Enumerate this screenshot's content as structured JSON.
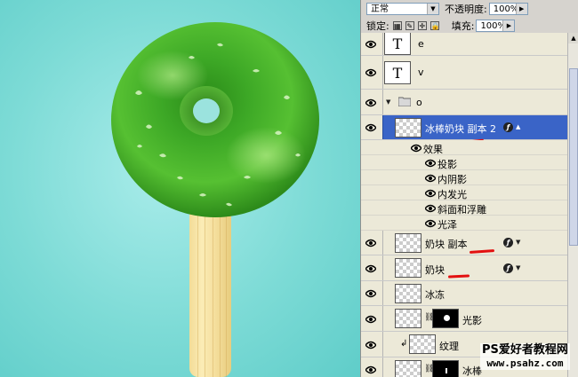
{
  "toolbar": {
    "blend_mode": "正常",
    "opacity_label": "不透明度:",
    "opacity_value": "100%",
    "lock_label": "锁定:",
    "fill_label": "填充:",
    "fill_value": "100%"
  },
  "layers": [
    {
      "id": "layer-e",
      "name": "e",
      "type": "text",
      "visible": true
    },
    {
      "id": "layer-v",
      "name": "v",
      "type": "text",
      "visible": true
    },
    {
      "id": "group-o",
      "name": "o",
      "type": "group",
      "visible": true
    },
    {
      "id": "layer-icebar-copy2",
      "name": "冰棒奶块 副本 2",
      "type": "pixel",
      "visible": true,
      "selected": true,
      "has_fx": true,
      "effects_label": "效果",
      "effects": [
        "投影",
        "内阴影",
        "内发光",
        "斜面和浮雕",
        "光泽"
      ]
    },
    {
      "id": "layer-milk-copy",
      "name": "奶块 副本",
      "type": "pixel",
      "visible": true,
      "has_fx": true
    },
    {
      "id": "layer-milk",
      "name": "奶块",
      "type": "pixel",
      "visible": true,
      "has_fx": true
    },
    {
      "id": "layer-ice",
      "name": "冰冻",
      "type": "pixel",
      "visible": true
    },
    {
      "id": "layer-light",
      "name": "光影",
      "type": "masked",
      "visible": true
    },
    {
      "id": "layer-texture",
      "name": "纹理",
      "type": "clipped",
      "visible": true
    },
    {
      "id": "layer-bottom",
      "name": "冰棒",
      "type": "masked",
      "visible": true
    }
  ],
  "watermark": {
    "line1": "PS爱好者教程网",
    "line2": "www.psahz.com"
  },
  "colors": {
    "panel": "#d6d3ce",
    "selected_row": "#3a64c7",
    "annotation": "#e31010",
    "donut": "#3aa623",
    "canvas": "#7ddbd6"
  }
}
